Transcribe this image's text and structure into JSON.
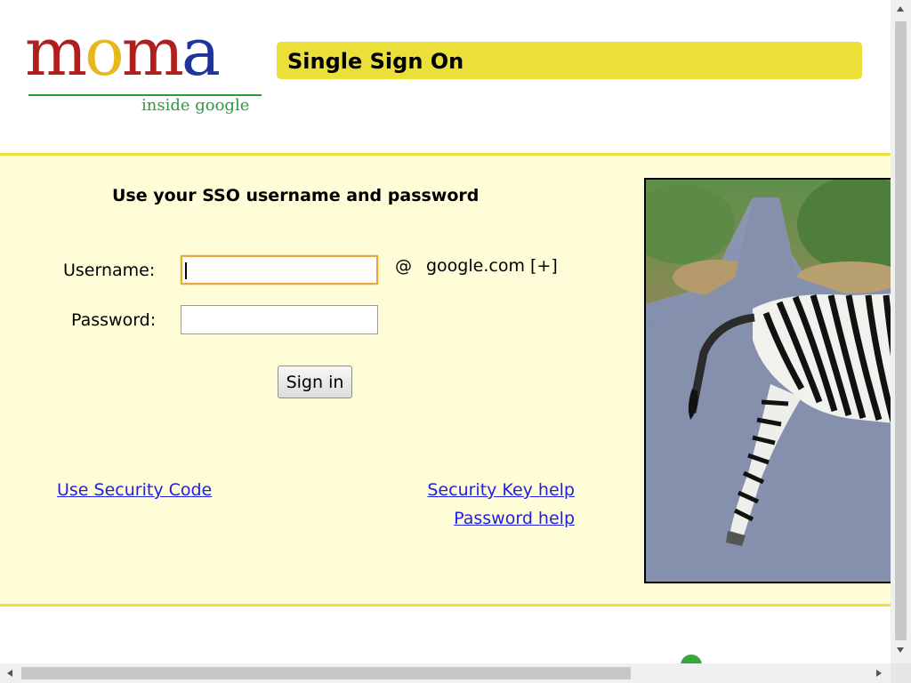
{
  "logo": {
    "letters": [
      "m",
      "o",
      "m",
      "a"
    ],
    "letter_colors": [
      "#b01e1e",
      "#e6b81c",
      "#b01e1e",
      "#21339c"
    ],
    "subtitle": "inside google"
  },
  "header": {
    "title": "Single Sign On",
    "bar_color": "#ebdf3a"
  },
  "form": {
    "heading": "Use your SSO username and password",
    "username_label": "Username:",
    "username_value": "",
    "password_label": "Password:",
    "password_value": "",
    "at_sign": "@",
    "domain": "google.com [+]",
    "signin_label": "Sign in"
  },
  "links": {
    "security_code": "Use Security Code",
    "security_key_help": "Security Key help",
    "password_help": "Password help"
  },
  "colors": {
    "panel_bg": "#fffdd8",
    "panel_border": "#ebdf3a",
    "link": "#2020e0"
  },
  "photo": {
    "subject": "zebra-on-road"
  }
}
